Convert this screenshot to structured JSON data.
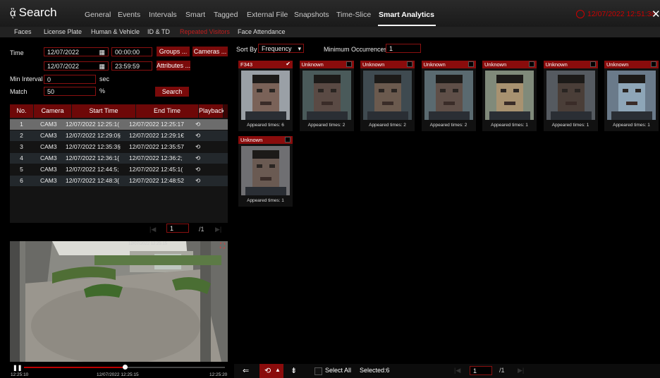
{
  "app": {
    "title": "Search"
  },
  "main_tabs": [
    "General",
    "Events",
    "Intervals",
    "Smart",
    "Tagged",
    "External File",
    "Snapshots",
    "Time-Slice",
    "Smart Analytics"
  ],
  "datetime": "12/07/2022 12:51:38",
  "sub_tabs": [
    "Faces",
    "License Plate",
    "Human & Vehicle",
    "ID & TD",
    "Repeated Visitors",
    "Face Attendance"
  ],
  "form": {
    "time_label": "Time",
    "start_date": "12/07/2022",
    "start_time": "00:00:00",
    "end_date": "12/07/2022",
    "end_time": "23:59:59",
    "groups_btn": "Groups ...",
    "cameras_btn": "Cameras ...",
    "attributes_btn": "Attributes ...",
    "min_interval_label": "Min Interval",
    "min_interval_value": "0",
    "min_interval_unit": "sec",
    "match_label": "Match",
    "match_value": "50",
    "match_unit": "%",
    "search_btn": "Search"
  },
  "table": {
    "headers": [
      "No.",
      "Camera",
      "Start Time",
      "End Time",
      "Playback"
    ],
    "rows": [
      {
        "no": "1",
        "camera": "CAM3",
        "start": "12/07/2022 12:25:1(",
        "end": "12/07/2022 12:25:17"
      },
      {
        "no": "2",
        "camera": "CAM3",
        "start": "12/07/2022 12:29:0§",
        "end": "12/07/2022 12:29:1€"
      },
      {
        "no": "3",
        "camera": "CAM3",
        "start": "12/07/2022 12:35:3§",
        "end": "12/07/2022 12:35:57"
      },
      {
        "no": "4",
        "camera": "CAM3",
        "start": "12/07/2022 12:36:1{",
        "end": "12/07/2022 12:36:2;"
      },
      {
        "no": "5",
        "camera": "CAM3",
        "start": "12/07/2022 12:44:5;",
        "end": "12/07/2022 12:45:1("
      },
      {
        "no": "6",
        "camera": "CAM3",
        "start": "12/07/2022 12:48:3{",
        "end": "12/07/2022 12:48:52"
      }
    ],
    "page": "1",
    "total_pages": "/1"
  },
  "video": {
    "timestamp": "12/07/2022 12:25:15",
    "start": "12:25:10",
    "end": "12:25:20",
    "progress": 0.5
  },
  "right": {
    "sort_by_label": "Sort By",
    "sort_by_value": "Frequency",
    "min_occ_label": "Minimum Occurrences",
    "min_occ_value": "1",
    "cards": [
      {
        "name": "F343",
        "caption": "Appeared times: 6",
        "checked": true
      },
      {
        "name": "Unknown",
        "caption": "Appeared times: 2",
        "checked": false
      },
      {
        "name": "Unknown",
        "caption": "Appeared times: 2",
        "checked": false
      },
      {
        "name": "Unknown",
        "caption": "Appeared times: 2",
        "checked": false
      },
      {
        "name": "Unknown",
        "caption": "Appeared times: 1",
        "checked": false
      },
      {
        "name": "Unknown",
        "caption": "Appeared times: 1",
        "checked": false
      },
      {
        "name": "Unknown",
        "caption": "Appeared times: 1",
        "checked": false
      },
      {
        "name": "Unknown",
        "caption": "Appeared times: 1",
        "checked": false
      }
    ],
    "select_all": "Select All",
    "selected": "Selected:6",
    "page": "1",
    "total_pages": "/1"
  },
  "colors": {
    "accent": "#8a0c0c",
    "header_red": "#6e0808",
    "time_red": "#cc0000"
  }
}
